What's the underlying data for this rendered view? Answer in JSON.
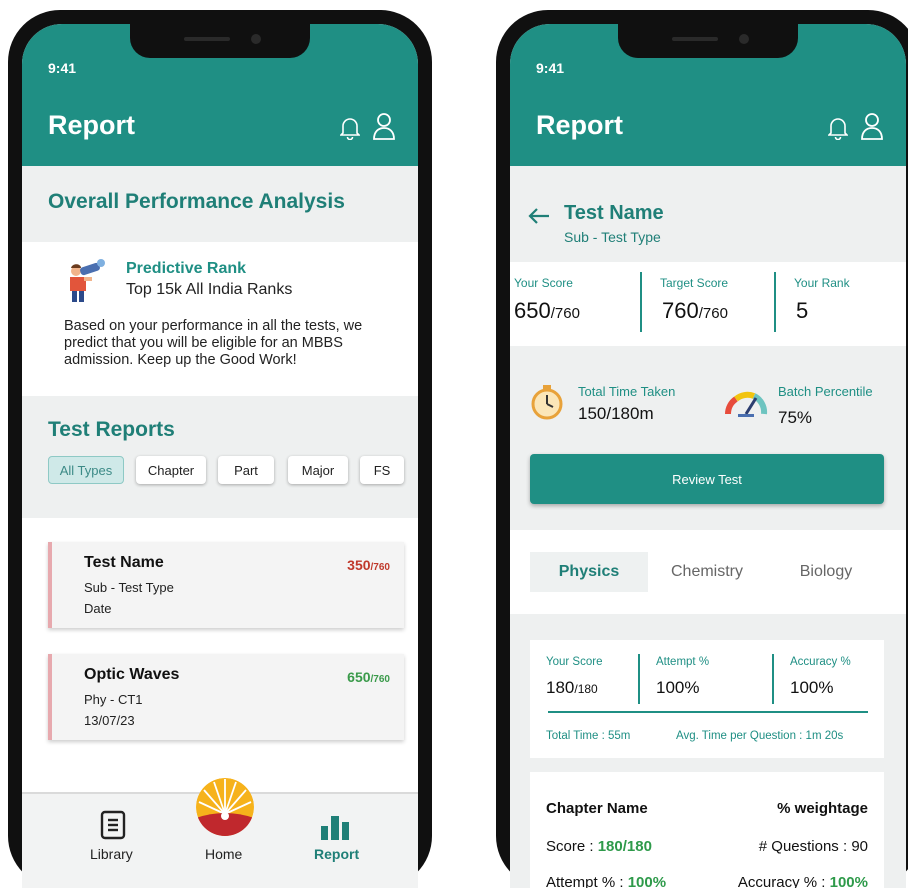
{
  "left": {
    "status_time": "9:41",
    "page_title": "Report",
    "overall": {
      "heading": "Overall Performance Analysis",
      "predictive_title": "Predictive Rank",
      "predictive_sub": "Top 15k All India Ranks",
      "description": "Based on your performance in all the tests, we predict that you will be eligible for an MBBS admission. Keep up the Good Work!"
    },
    "test_reports": {
      "heading": "Test Reports",
      "filters": [
        "All Types",
        "Chapter",
        "Part",
        "Major",
        "FS"
      ],
      "active_filter": "All Types",
      "cards": [
        {
          "name": "Test Name",
          "sub": "Sub - Test Type",
          "date": "Date",
          "score": "350",
          "total": "/760",
          "score_color": "#c0392b"
        },
        {
          "name": "Optic Waves",
          "sub": "Phy - CT1",
          "date": "13/07/23",
          "score": "650",
          "total": "/760",
          "score_color": "#3a9a4a"
        }
      ]
    },
    "nav": {
      "library": "Library",
      "home": "Home",
      "report": "Report",
      "active": "Report"
    }
  },
  "right": {
    "status_time": "9:41",
    "page_title": "Report",
    "test_name": "Test Name",
    "test_sub": "Sub - Test Type",
    "scores": {
      "your_score_label": "Your Score",
      "your_score": "650",
      "your_score_total": "/760",
      "target_score_label": "Target Score",
      "target_score": "760",
      "target_score_total": "/760",
      "your_rank_label": "Your Rank",
      "your_rank": "5"
    },
    "time": {
      "label": "Total Time Taken",
      "value": "150/180m"
    },
    "percentile": {
      "label": "Batch Percentile",
      "value": "75%"
    },
    "review_button": "Review Test",
    "tabs": [
      "Physics",
      "Chemistry",
      "Biology"
    ],
    "active_tab": "Physics",
    "subject": {
      "your_score_label": "Your Score",
      "your_score": "180",
      "your_score_total": "/180",
      "attempt_label": "Attempt %",
      "attempt": "100%",
      "accuracy_label": "Accuracy %",
      "accuracy": "100%",
      "total_time": "Total Time : 55m",
      "avg_time": "Avg. Time per Question : 1m 20s"
    },
    "chapter": {
      "name_heading": "Chapter Name",
      "weightage_heading": "% weightage",
      "score_label": "Score : ",
      "score_value": "180/180",
      "questions": "# Questions : 90",
      "attempt_label": "Attempt % : ",
      "attempt_value": "100%",
      "accuracy_label": "Accuracy % : ",
      "accuracy_value": "100%"
    }
  },
  "colors": {
    "teal": "#1f8f84",
    "green": "#3a9a4a",
    "red": "#c0392b"
  }
}
